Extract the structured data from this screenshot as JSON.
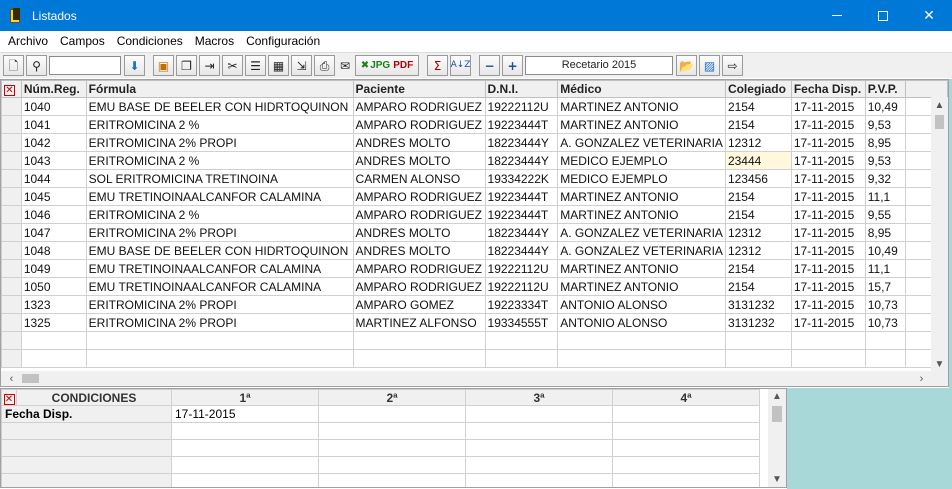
{
  "window": {
    "title": "Listados"
  },
  "menu": [
    {
      "label": "Archivo"
    },
    {
      "label": "Campos"
    },
    {
      "label": "Condiciones"
    },
    {
      "label": "Macros"
    },
    {
      "label": "Configuración"
    }
  ],
  "toolbar": {
    "recetario_value": "Recetario 2015",
    "jpg_label": "JPG",
    "pdf_label": "PDF",
    "sigma_label": "Σ"
  },
  "grid": {
    "columns": [
      "Núm.Reg.",
      "Fórmula",
      "Paciente",
      "D.N.I.",
      "Médico",
      "Colegiado",
      "Fecha Disp.",
      "P.V.P."
    ],
    "rows": [
      [
        "1040",
        "EMU BASE DE BEELER CON HIDRTOQUINON",
        "AMPARO RODRIGUEZ",
        "19222112U",
        "MARTINEZ ANTONIO",
        "2154",
        "17-11-2015",
        "10,49"
      ],
      [
        "1041",
        "ERITROMICINA 2 %",
        "AMPARO RODRIGUEZ",
        "19223444T",
        "MARTINEZ ANTONIO",
        "2154",
        "17-11-2015",
        "9,53"
      ],
      [
        "1042",
        "ERITROMICINA 2% PROPI",
        "ANDRES MOLTO",
        "18223444Y",
        "A. GONZALEZ VETERINARIA",
        "12312",
        "17-11-2015",
        "8,95"
      ],
      [
        "1043",
        "ERITROMICINA 2 %",
        "ANDRES MOLTO",
        "18223444Y",
        "MEDICO EJEMPLO",
        "23444",
        "17-11-2015",
        "9,53"
      ],
      [
        "1044",
        "SOL ERITROMICINA TRETINOINA",
        "CARMEN ALONSO",
        "19334222K",
        "MEDICO EJEMPLO",
        "123456",
        "17-11-2015",
        "9,32"
      ],
      [
        "1045",
        "EMU TRETINOINAALCANFOR CALAMINA",
        "AMPARO RODRIGUEZ",
        "19223444T",
        "MARTINEZ ANTONIO",
        "2154",
        "17-11-2015",
        "11,1"
      ],
      [
        "1046",
        "ERITROMICINA 2 %",
        "AMPARO RODRIGUEZ",
        "19223444T",
        "MARTINEZ ANTONIO",
        "2154",
        "17-11-2015",
        "9,55"
      ],
      [
        "1047",
        "ERITROMICINA 2% PROPI",
        "ANDRES MOLTO",
        "18223444Y",
        "A. GONZALEZ VETERINARIA",
        "12312",
        "17-11-2015",
        "8,95"
      ],
      [
        "1048",
        "EMU BASE DE BEELER CON HIDRTOQUINON",
        "ANDRES MOLTO",
        "18223444Y",
        "A. GONZALEZ VETERINARIA",
        "12312",
        "17-11-2015",
        "10,49"
      ],
      [
        "1049",
        "EMU TRETINOINAALCANFOR CALAMINA",
        "AMPARO RODRIGUEZ",
        "19222112U",
        "MARTINEZ ANTONIO",
        "2154",
        "17-11-2015",
        "11,1"
      ],
      [
        "1050",
        "EMU TRETINOINAALCANFOR CALAMINA",
        "AMPARO RODRIGUEZ",
        "19222112U",
        "MARTINEZ ANTONIO",
        "2154",
        "17-11-2015",
        "15,7"
      ],
      [
        "1323",
        "ERITROMICINA 2% PROPI",
        "AMPARO GOMEZ",
        "19223334T",
        "ANTONIO ALONSO",
        "3131232",
        "17-11-2015",
        "10,73"
      ],
      [
        "1325",
        "ERITROMICINA 2% PROPI",
        "MARTINEZ ALFONSO",
        "19334555T",
        "ANTONIO ALONSO",
        "3131232",
        "17-11-2015",
        "10,73"
      ]
    ]
  },
  "conditions": {
    "header": "CONDICIONES",
    "columns": [
      "1ª",
      "2ª",
      "3ª",
      "4ª"
    ],
    "rows": [
      {
        "label": "Fecha Disp.",
        "values": [
          "17-11-2015",
          "",
          "",
          ""
        ]
      }
    ]
  }
}
